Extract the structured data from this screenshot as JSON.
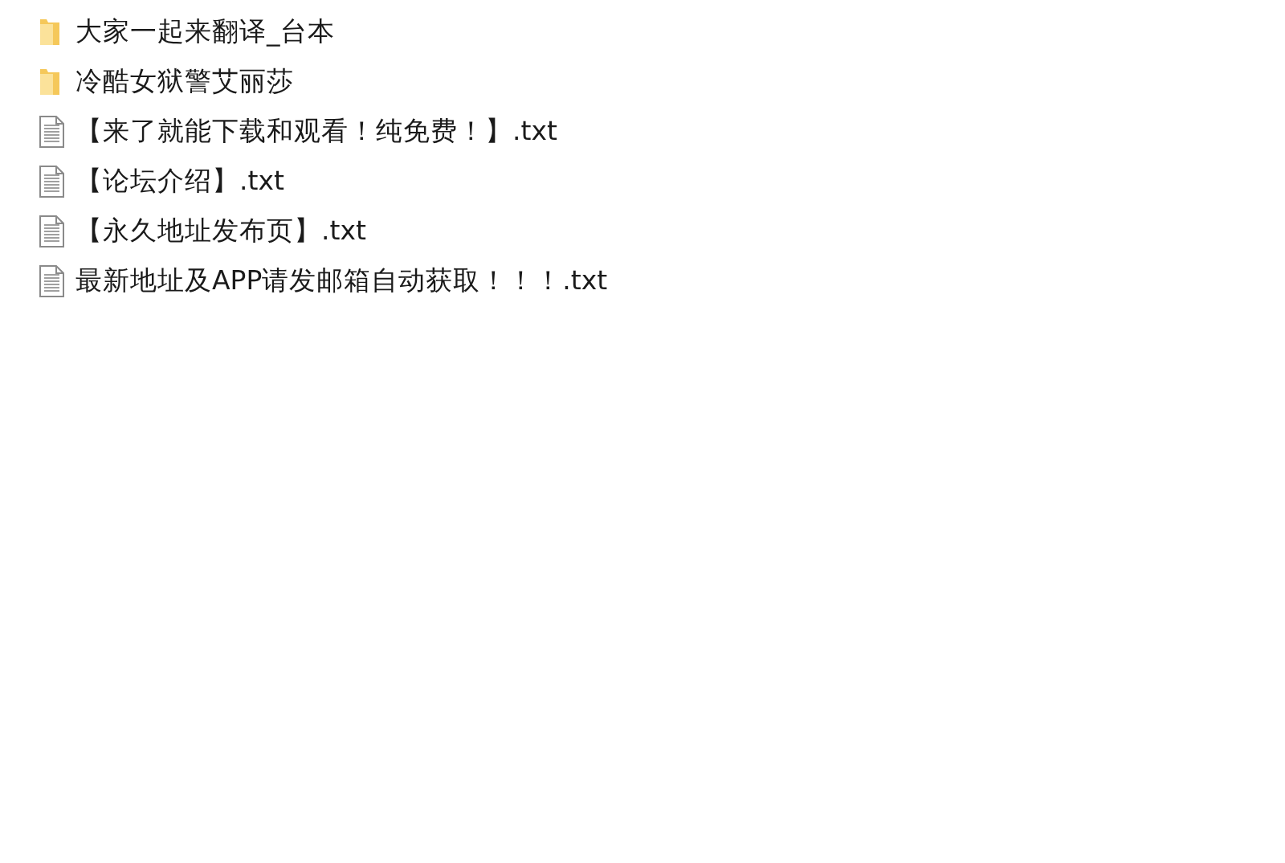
{
  "files": [
    {
      "kind": "folder",
      "name": "大家一起来翻译_台本"
    },
    {
      "kind": "folder",
      "name": "冷酷女狱警艾丽莎"
    },
    {
      "kind": "file",
      "name": "【来了就能下载和观看！纯免费！】.txt"
    },
    {
      "kind": "file",
      "name": "【论坛介绍】.txt"
    },
    {
      "kind": "file",
      "name": "【永久地址发布页】.txt"
    },
    {
      "kind": "file",
      "name": "最新地址及APP请发邮箱自动获取！！！.txt"
    }
  ]
}
